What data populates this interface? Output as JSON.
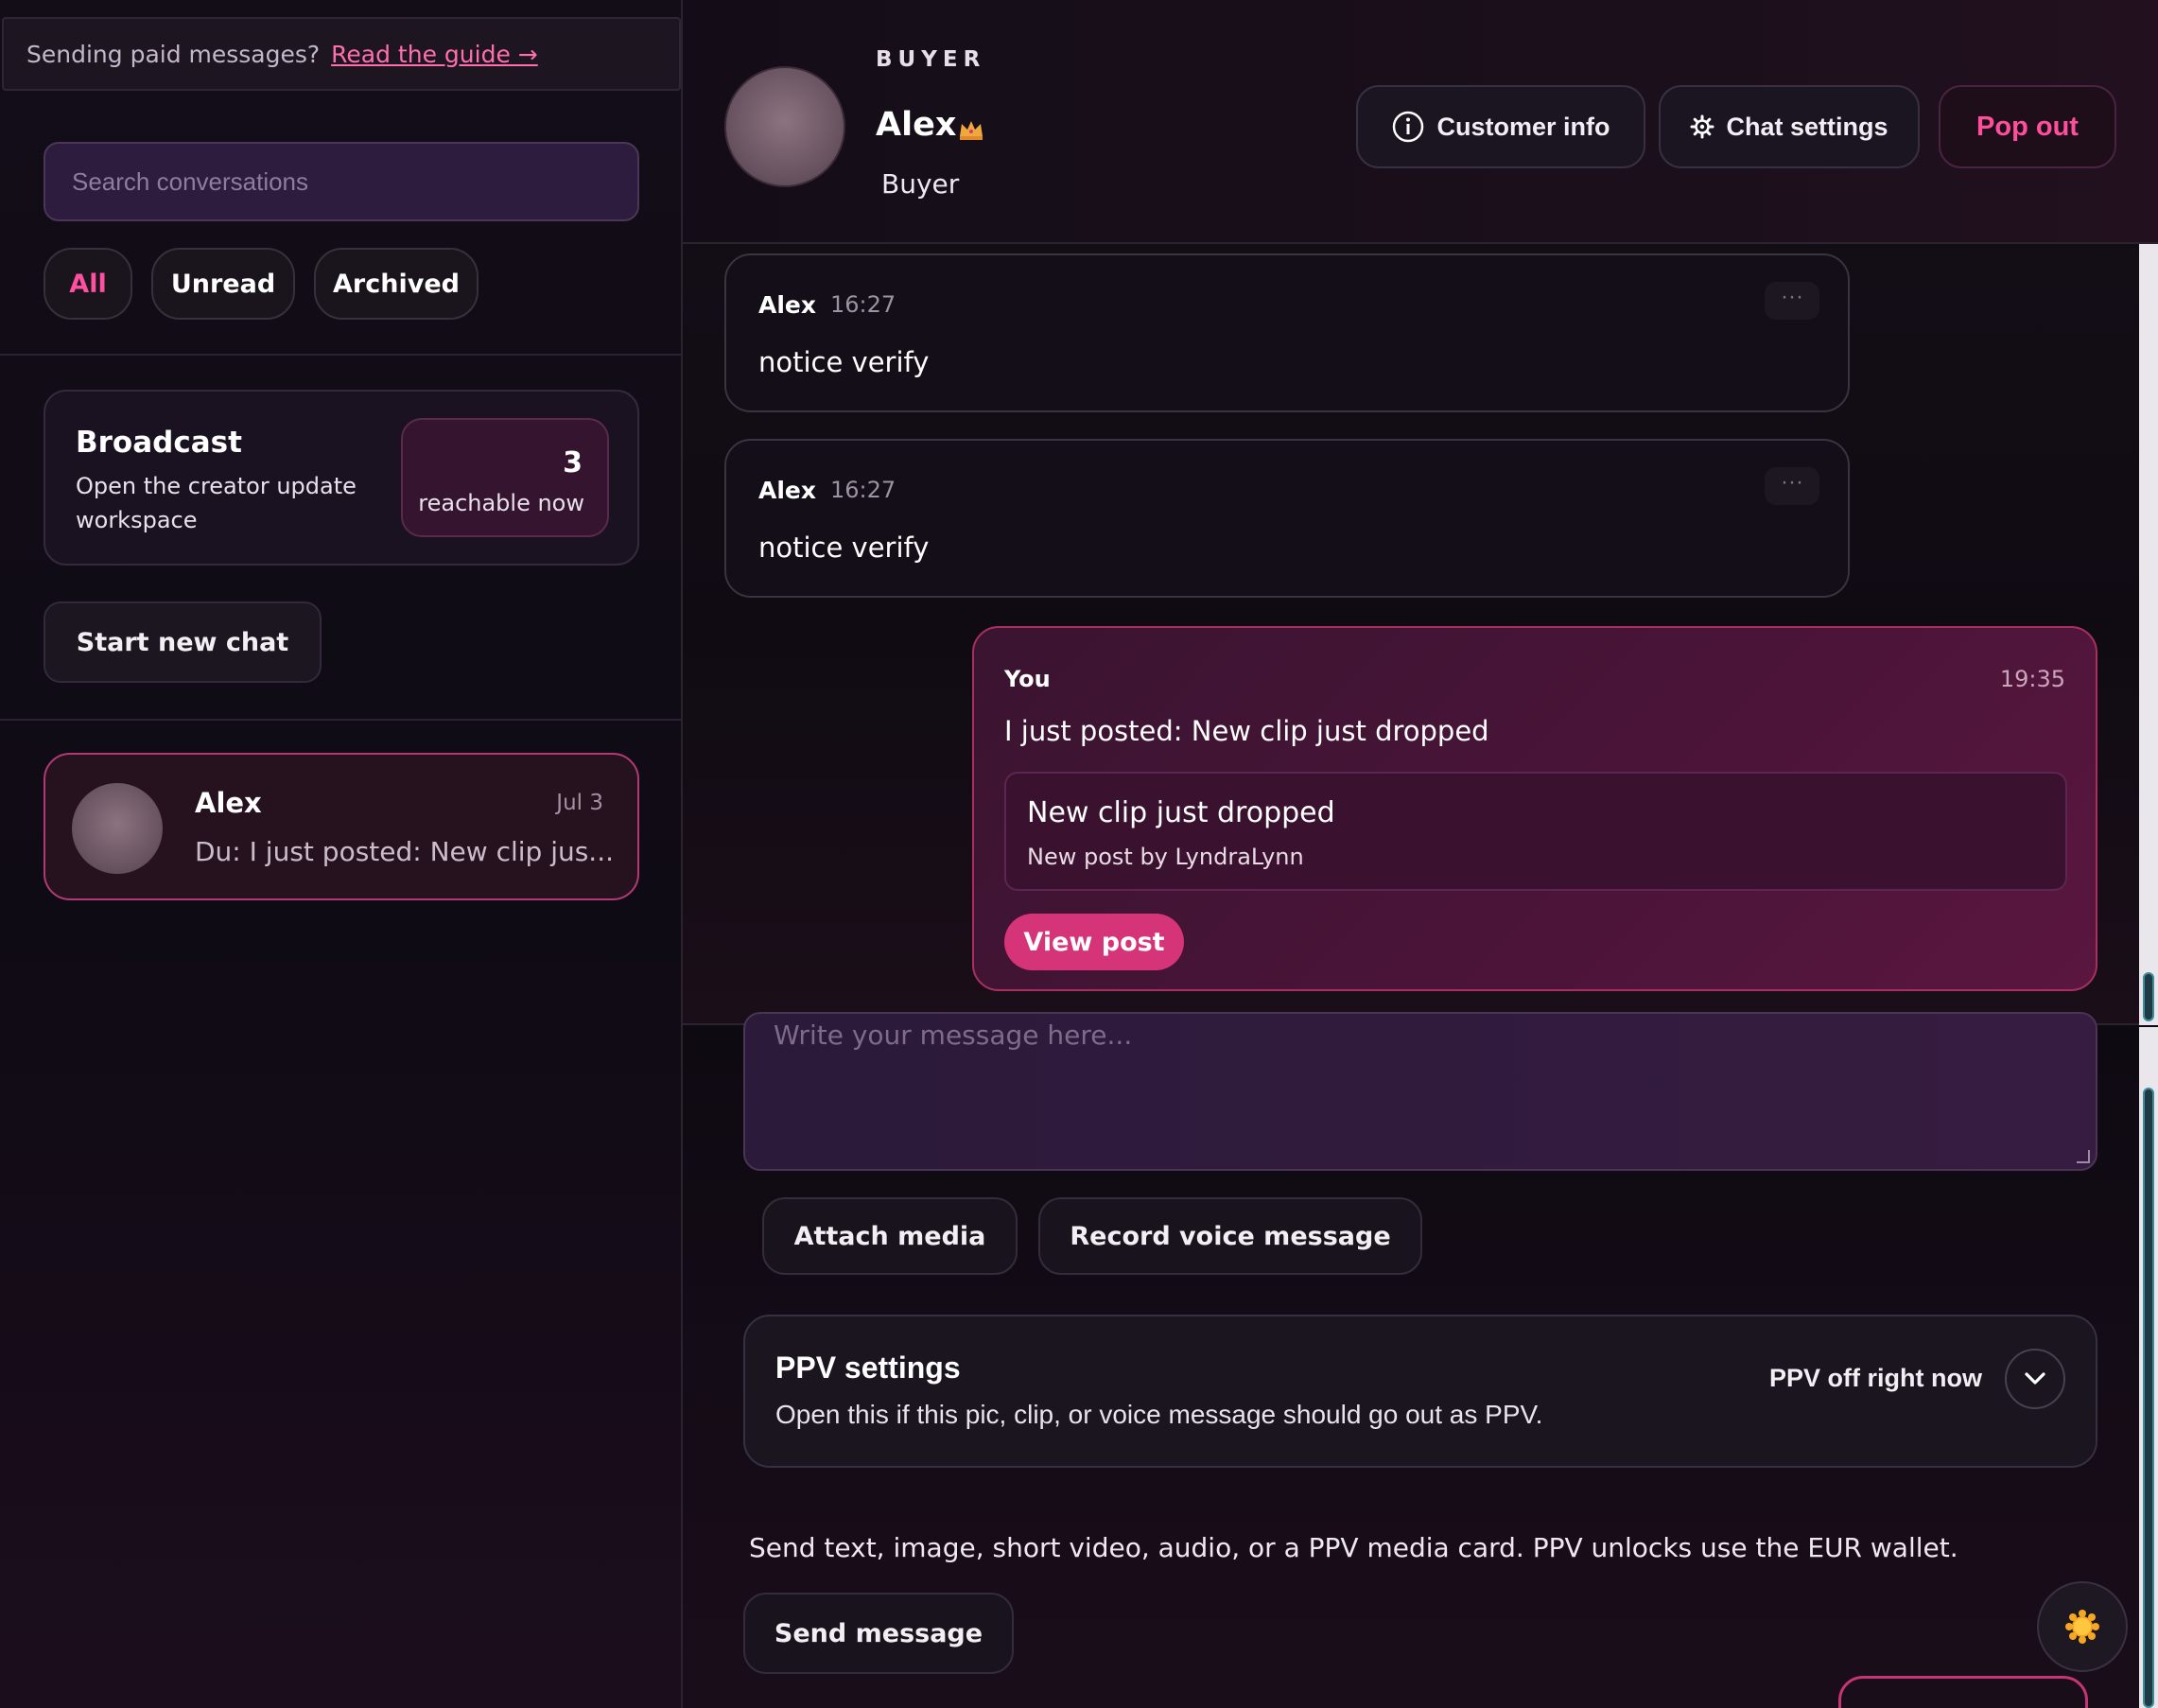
{
  "sidebar": {
    "guide": {
      "text": "Sending paid messages?",
      "link": "Read the guide →"
    },
    "search": {
      "placeholder": "Search conversations"
    },
    "filters": [
      {
        "label": "All",
        "active": true
      },
      {
        "label": "Unread",
        "active": false
      },
      {
        "label": "Archived",
        "active": false
      }
    ],
    "broadcast": {
      "title": "Broadcast",
      "subtitle": "Open the creator update workspace",
      "count": "3",
      "count_label": "reachable now"
    },
    "start_chat_label": "Start new chat",
    "conversations": [
      {
        "name": "Alex",
        "date": "Jul 3",
        "preview": "Du: I just posted: New clip jus..."
      }
    ]
  },
  "header": {
    "role": "BUYER",
    "name": "Alex",
    "subtitle": "Buyer",
    "crown_icon": "crown-icon",
    "buttons": {
      "customer_info": "Customer info",
      "chat_settings": "Chat settings",
      "pop_out": "Pop out"
    }
  },
  "messages": [
    {
      "author": "Alex",
      "time": "16:27",
      "text": "notice verify",
      "more": "···"
    },
    {
      "author": "Alex",
      "time": "16:27",
      "text": "notice verify",
      "more": "···"
    }
  ],
  "outgoing": {
    "author": "You",
    "time": "19:35",
    "text": "I just posted: New clip just dropped",
    "card": {
      "title": "New clip just dropped",
      "subtitle": "New post by LyndraLynn"
    },
    "action": "View post"
  },
  "composer": {
    "placeholder": "Write your message here...",
    "attach_label": "Attach media",
    "voice_label": "Record voice message"
  },
  "ppv": {
    "title": "PPV settings",
    "description": "Open this if this pic, clip, or voice message should go out as PPV.",
    "state": "PPV off right now"
  },
  "hint": "Send text, image, short video, audio, or a PPV media card. PPV unlocks use the EUR wallet.",
  "send_label": "Send message",
  "colors": {
    "accent": "#ff4f9c",
    "button_pink": "#d63478",
    "bubble_border": "#a8305f"
  }
}
